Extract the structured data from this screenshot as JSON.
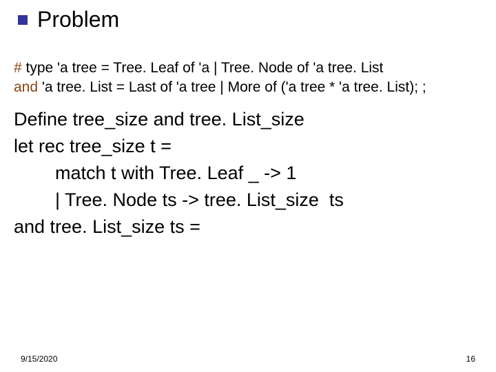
{
  "title": "Problem",
  "def": {
    "hash": "#",
    "type_line": " type 'a tree = Tree. Leaf of 'a | Tree. Node of 'a tree. List",
    "and_kw": "and",
    "and_line": " 'a tree. List = Last of 'a tree | More of ('a tree * 'a tree. List); ;"
  },
  "body": {
    "l1": "Define tree_size and tree. List_size",
    "l2": "let rec tree_size t =",
    "l3": "match t with Tree. Leaf _ -> 1",
    "l4": "| Tree. Node ts -> tree. List_size  ts",
    "l5": "and tree. List_size ts ="
  },
  "footer": {
    "date": "9/15/2020",
    "page": "16"
  }
}
